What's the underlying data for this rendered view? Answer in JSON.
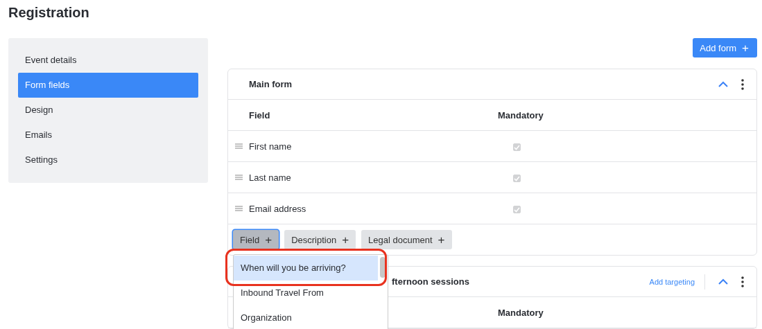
{
  "page_title": "Registration",
  "sidebar": {
    "items": [
      {
        "label": "Event details",
        "selected": false
      },
      {
        "label": "Form fields",
        "selected": true
      },
      {
        "label": "Design",
        "selected": false
      },
      {
        "label": "Emails",
        "selected": false
      },
      {
        "label": "Settings",
        "selected": false
      }
    ]
  },
  "add_form_button": {
    "label": "Add form",
    "icon": "+"
  },
  "forms": [
    {
      "title": "Main form",
      "expanded": true,
      "columns": [
        "Field",
        "Mandatory"
      ],
      "rows": [
        {
          "field": "First name",
          "mandatory": true,
          "disabled": true
        },
        {
          "field": "Last name",
          "mandatory": true,
          "disabled": true
        },
        {
          "field": "Email address",
          "mandatory": true,
          "disabled": true
        }
      ],
      "add_buttons": [
        {
          "label": "Field",
          "icon": "+",
          "selected": true
        },
        {
          "label": "Description",
          "icon": "+",
          "selected": false
        },
        {
          "label": "Legal document",
          "icon": "+",
          "selected": false
        }
      ]
    },
    {
      "title": "fternoon sessions",
      "expanded": true,
      "targeting_link": "Add targeting",
      "columns": [
        "",
        "Mandatory"
      ]
    }
  ],
  "dropdown": {
    "items": [
      {
        "label": "When will you be arriving?",
        "selected": true
      },
      {
        "label": "Inbound Travel From",
        "selected": false
      },
      {
        "label": "Organization",
        "selected": false
      }
    ]
  }
}
